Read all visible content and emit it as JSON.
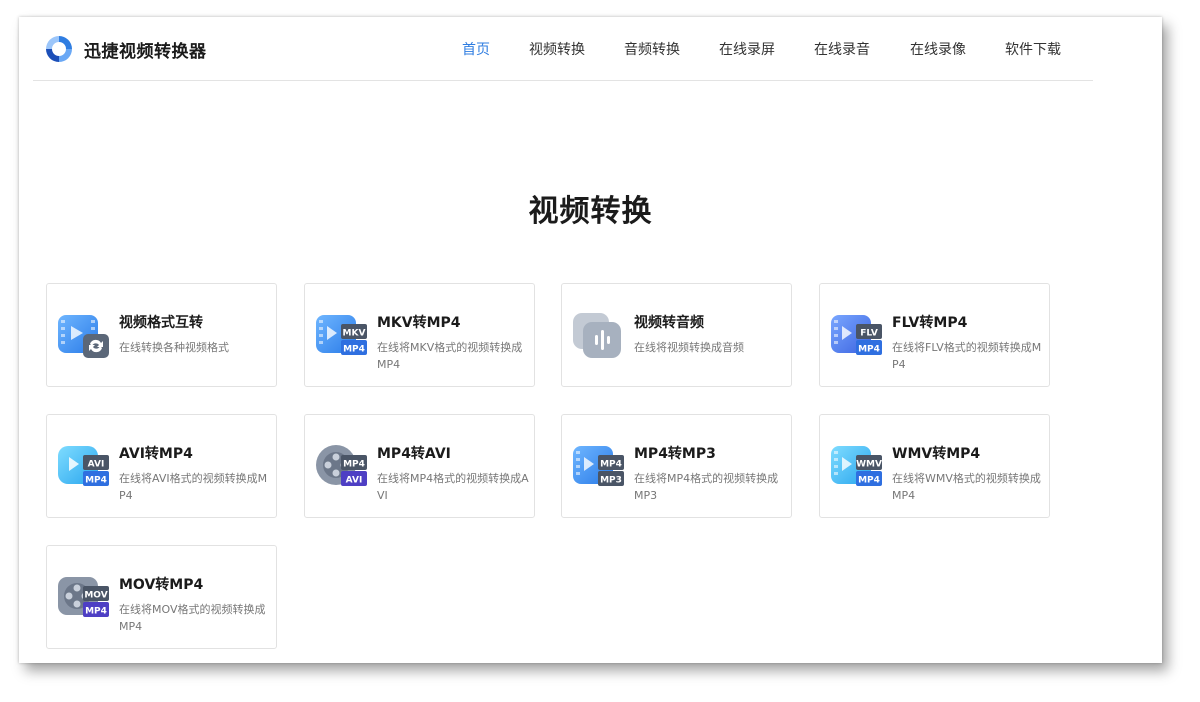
{
  "header": {
    "brand": "迅捷视频转换器",
    "nav": [
      {
        "label": "首页",
        "active": true
      },
      {
        "label": "视频转换"
      },
      {
        "label": "音频转换"
      },
      {
        "label": "在线录屏"
      },
      {
        "label": "在线录音"
      },
      {
        "label": "在线录像"
      },
      {
        "label": "软件下载"
      }
    ]
  },
  "main": {
    "title": "视频转换",
    "cards": [
      {
        "title": "视频格式互转",
        "desc": "在线转换各种视频格式",
        "icon": "video-convert-icon"
      },
      {
        "title": "MKV转MP4",
        "desc": "在线将MKV格式的视频转换成MP4",
        "icon": "mkv-to-mp4-icon",
        "tag_top": "MKV",
        "tag_bottom": "MP4"
      },
      {
        "title": "视频转音频",
        "desc": "在线将视频转换成音频",
        "icon": "video-to-audio-icon"
      },
      {
        "title": "FLV转MP4",
        "desc": "在线将FLV格式的视频转换成MP4",
        "icon": "flv-to-mp4-icon",
        "tag_top": "FLV",
        "tag_bottom": "MP4"
      },
      {
        "title": "AVI转MP4",
        "desc": "在线将AVI格式的视频转换成MP4",
        "icon": "avi-to-mp4-icon",
        "tag_top": "AVI",
        "tag_bottom": "MP4"
      },
      {
        "title": "MP4转AVI",
        "desc": "在线将MP4格式的视频转换成AVI",
        "icon": "mp4-to-avi-icon",
        "tag_top": "MP4",
        "tag_bottom": "AVI"
      },
      {
        "title": "MP4转MP3",
        "desc": "在线将MP4格式的视频转换成MP3",
        "icon": "mp4-to-mp3-icon",
        "tag_top": "MP4",
        "tag_bottom": "MP3"
      },
      {
        "title": "WMV转MP4",
        "desc": "在线将WMV格式的视频转换成MP4",
        "icon": "wmv-to-mp4-icon",
        "tag_top": "WMV",
        "tag_bottom": "MP4"
      },
      {
        "title": "MOV转MP4",
        "desc": "在线将MOV格式的视频转换成MP4",
        "icon": "mov-to-mp4-icon",
        "tag_top": "MOV",
        "tag_bottom": "MP4"
      }
    ]
  },
  "colors": {
    "accent": "#2f7de1",
    "tag_dark": "#4a5566",
    "tag_blue": "#2f6fe0",
    "tag_purple": "#4e3fc4"
  }
}
